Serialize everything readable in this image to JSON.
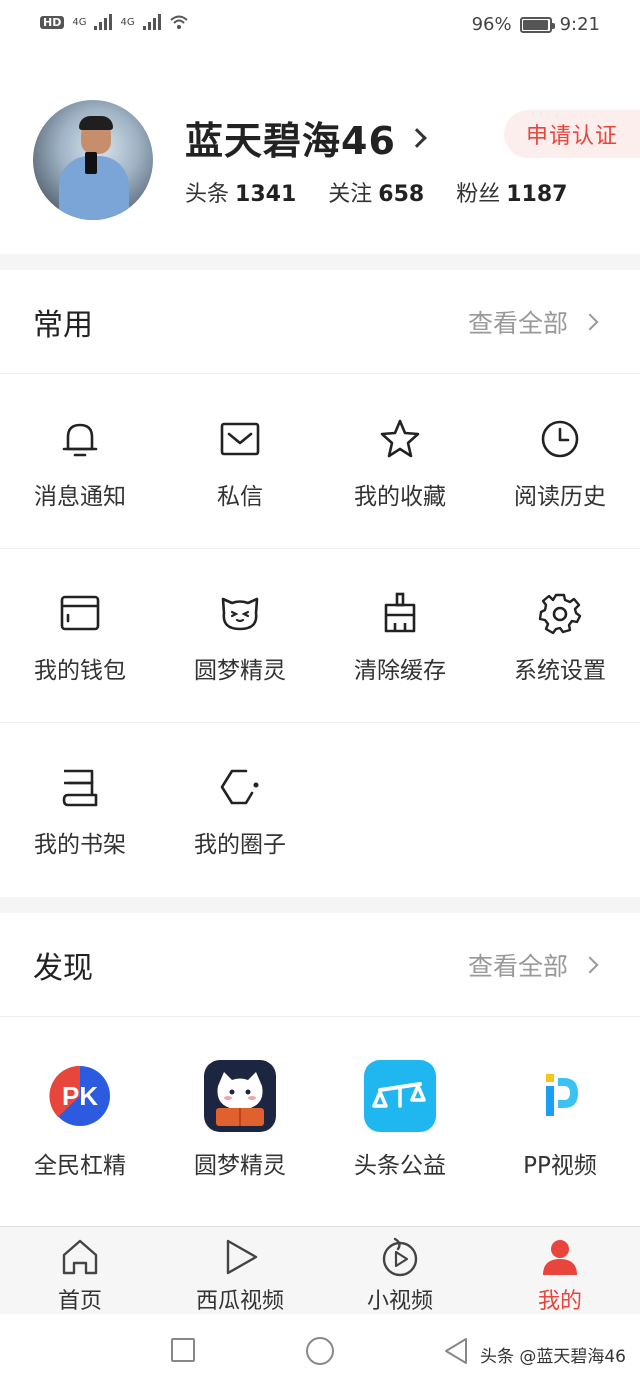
{
  "status_bar": {
    "hd": "HD",
    "net1": "4G",
    "net2": "4G",
    "battery": "96%",
    "battery_level": 0.96,
    "time": "9:21"
  },
  "profile": {
    "username": "蓝天碧海46",
    "cert_label": "申请认证",
    "stats": [
      {
        "label": "头条",
        "value": "1341"
      },
      {
        "label": "关注",
        "value": "658"
      },
      {
        "label": "粉丝",
        "value": "1187"
      }
    ]
  },
  "common": {
    "title": "常用",
    "view_all": "查看全部",
    "items": [
      {
        "label": "消息通知",
        "icon": "bell-icon"
      },
      {
        "label": "私信",
        "icon": "mail-icon"
      },
      {
        "label": "我的收藏",
        "icon": "star-icon"
      },
      {
        "label": "阅读历史",
        "icon": "clock-icon"
      },
      {
        "label": "我的钱包",
        "icon": "wallet-icon"
      },
      {
        "label": "圆梦精灵",
        "icon": "cat-face-icon"
      },
      {
        "label": "清除缓存",
        "icon": "broom-icon"
      },
      {
        "label": "系统设置",
        "icon": "gear-icon"
      },
      {
        "label": "我的书架",
        "icon": "bookshelf-icon"
      },
      {
        "label": "我的圈子",
        "icon": "circle-group-icon"
      }
    ]
  },
  "discover": {
    "title": "发现",
    "view_all": "查看全部",
    "items": [
      {
        "label": "全民杠精",
        "icon": "pk-app-icon",
        "accent": "#e8453c"
      },
      {
        "label": "圆梦精灵",
        "icon": "dream-cat-app-icon",
        "accent": "#1d2640"
      },
      {
        "label": "头条公益",
        "icon": "scale-app-icon",
        "accent": "#20b6f0"
      },
      {
        "label": "PP视频",
        "icon": "pp-video-app-icon",
        "accent": "#1aa0f0"
      }
    ]
  },
  "tabbar": {
    "tabs": [
      {
        "label": "首页",
        "icon": "home-icon"
      },
      {
        "label": "西瓜视频",
        "icon": "play-icon"
      },
      {
        "label": "小视频",
        "icon": "short-video-icon"
      },
      {
        "label": "我的",
        "icon": "person-icon"
      }
    ],
    "active_color": "#e8453c"
  },
  "watermark": "头条 @蓝天碧海46"
}
